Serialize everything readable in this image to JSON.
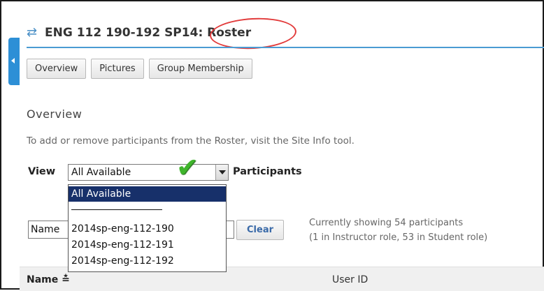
{
  "title": {
    "site": "ENG 112 190-192 SP14",
    "separator": ": ",
    "tool": "Roster",
    "icon": "swap-arrows-icon"
  },
  "tabs": [
    "Overview",
    "Pictures",
    "Group Membership"
  ],
  "section": {
    "title": "Overview",
    "intro": "To add or remove participants from the Roster, visit the Site Info tool."
  },
  "view": {
    "label": "View",
    "selected": "All Available",
    "suffix": "Participants",
    "options": [
      "All Available",
      "2014sp-eng-112-190",
      "2014sp-eng-112-191",
      "2014sp-eng-112-192"
    ]
  },
  "search": {
    "value": "Name",
    "clear_label": "Clear"
  },
  "status": {
    "line1": "Currently showing 54 participants",
    "line2": "(1 in Instructor role, 53 in Student role)"
  },
  "table": {
    "col_name": "Name ≛",
    "col_userid": "User ID"
  },
  "colors": {
    "accent": "#4a9bd3",
    "annotation_circle": "#e23b3b",
    "checkmark": "#3fb52c",
    "dropdown_selected": "#17306a"
  }
}
